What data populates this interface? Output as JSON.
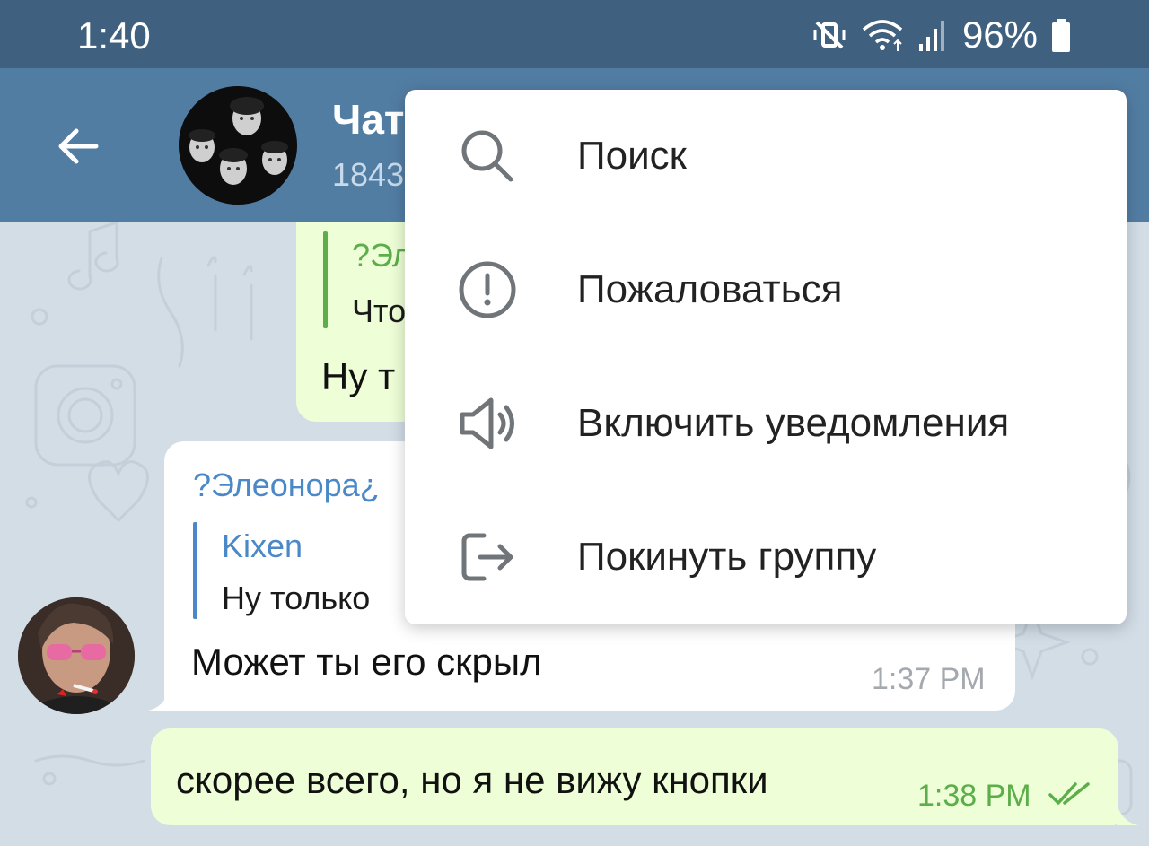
{
  "status_bar": {
    "time": "1:40",
    "battery": "96%",
    "icons": [
      "vibrate-mute-icon",
      "wifi-icon",
      "signal-icon",
      "battery-icon"
    ]
  },
  "header": {
    "title": "Чат",
    "subtitle": "1843"
  },
  "messages": {
    "out_partial": {
      "reply_name": "?Эл",
      "reply_text": "Что",
      "text": "Ну т"
    },
    "in_message": {
      "sender": "?Элеонора¿",
      "reply_name": "Kixen",
      "reply_text": "Ну только",
      "text": "Может ты его скрыл",
      "time": "1:37 PM"
    },
    "out_message": {
      "text": "скорее всего, но я не вижу кнопки",
      "time": "1:38 PM"
    }
  },
  "menu": {
    "items": [
      {
        "label": "Поиск",
        "icon": "search-icon"
      },
      {
        "label": "Пожаловаться",
        "icon": "report-icon"
      },
      {
        "label": "Включить уведомления",
        "icon": "speaker-icon"
      },
      {
        "label": "Покинуть группу",
        "icon": "leave-icon"
      }
    ]
  },
  "colors": {
    "status_bar": "#40607f",
    "app_bar": "#527da3",
    "chat_bg": "#d3dde6",
    "outgoing_bubble": "#eefed6",
    "incoming_bubble": "#ffffff",
    "green_accent": "#5cae4b",
    "blue_accent": "#4a88c7"
  }
}
